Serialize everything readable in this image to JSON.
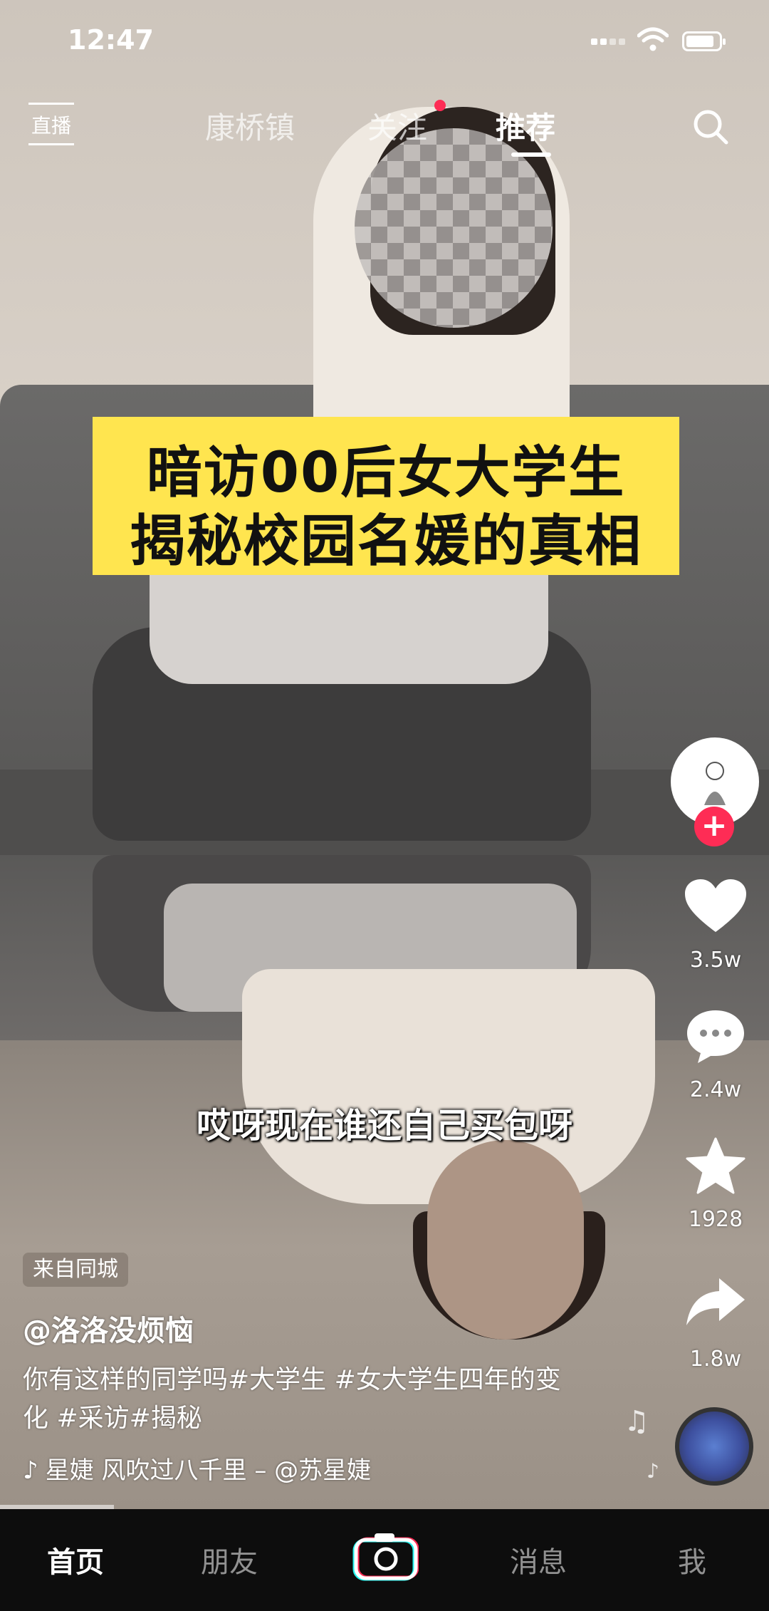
{
  "status_bar": {
    "time": "12:47"
  },
  "top_nav": {
    "live_label": "直播",
    "tabs": [
      {
        "label": "康桥镇",
        "active": false
      },
      {
        "label": "关注",
        "active": false,
        "has_dot": true
      },
      {
        "label": "推荐",
        "active": true
      }
    ]
  },
  "video": {
    "title_lines": [
      "暗访00后女大学生",
      "揭秘校园名媛的真相"
    ],
    "subtitle": "哎呀现在谁还自己买包呀"
  },
  "right_rail": {
    "like_count": "3.5w",
    "comment_count": "2.4w",
    "favorite_count": "1928",
    "share_count": "1.8w"
  },
  "post": {
    "badge": "来自同城",
    "author": "@洛洛没烦恼",
    "description": "你有这样的同学吗#大学生 #女大学生四年的变化 #采访#揭秘",
    "music": "星婕   风吹过八千里 – @苏星婕"
  },
  "tab_bar": {
    "items": [
      {
        "label": "首页",
        "active": true
      },
      {
        "label": "朋友",
        "active": false
      },
      {
        "label": "消息",
        "active": false
      },
      {
        "label": "我",
        "active": false
      }
    ]
  },
  "colors": {
    "accent": "#fe2c55",
    "title_bg": "#ffe54f"
  }
}
